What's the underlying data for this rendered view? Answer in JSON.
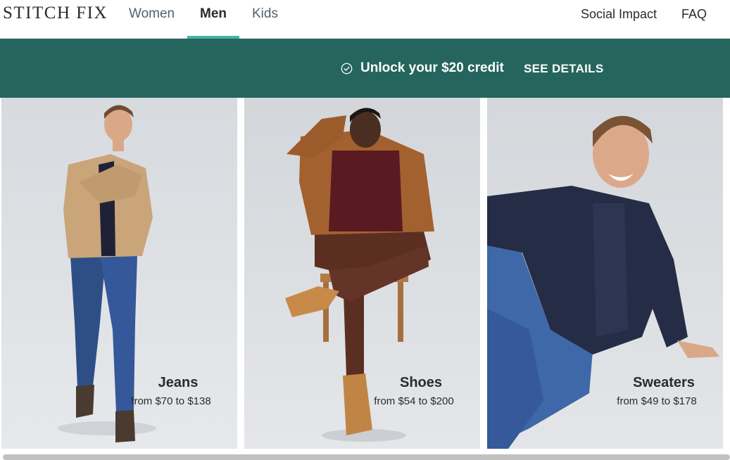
{
  "brand": {
    "logo_text": "STITCH FIX"
  },
  "nav": {
    "items": [
      {
        "label": "Women",
        "active": false
      },
      {
        "label": "Men",
        "active": true
      },
      {
        "label": "Kids",
        "active": false
      }
    ],
    "right_items": [
      {
        "label": "Social Impact"
      },
      {
        "label": "FAQ"
      }
    ],
    "accent_color": "#46b3a7"
  },
  "banner": {
    "icon": "check-circle-icon",
    "text": "Unlock your $20 credit",
    "link_label": "SEE DETAILS",
    "background_color": "#25655d"
  },
  "categories": [
    {
      "title": "Jeans",
      "price_range": "from $70 to $138",
      "image": "man-in-jacket-and-jeans-photo"
    },
    {
      "title": "Shoes",
      "price_range": "from $54 to $200",
      "image": "man-seated-on-chair-in-boots-photo"
    },
    {
      "title": "Sweaters",
      "price_range": "from $49 to $178",
      "image": "man-in-cable-knit-sweater-photo"
    }
  ]
}
